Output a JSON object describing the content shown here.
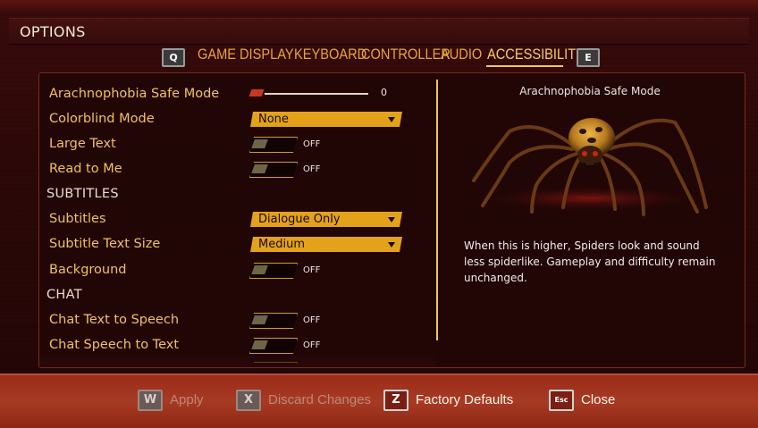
{
  "header": {
    "title": "OPTIONS"
  },
  "tabs": {
    "prev_key": "Q",
    "next_key": "E",
    "items": [
      {
        "label": "GAME"
      },
      {
        "label": "DISPLAY"
      },
      {
        "label": "KEYBOARD"
      },
      {
        "label": "CONTROLLER"
      },
      {
        "label": "AUDIO"
      },
      {
        "label": "ACCESSIBILITY",
        "active": true
      }
    ]
  },
  "settings": {
    "arachnophobia": {
      "label": "Arachnophobia Safe Mode",
      "value": "0",
      "level": 0
    },
    "colorblind": {
      "label": "Colorblind Mode",
      "value": "None"
    },
    "large_text": {
      "label": "Large Text",
      "state": "OFF"
    },
    "read_to_me": {
      "label": "Read to Me",
      "state": "OFF"
    },
    "subtitles_section": "SUBTITLES",
    "subtitles": {
      "label": "Subtitles",
      "value": "Dialogue Only"
    },
    "subtitle_size": {
      "label": "Subtitle Text Size",
      "value": "Medium"
    },
    "background": {
      "label": "Background",
      "state": "OFF"
    },
    "chat_section": "CHAT",
    "chat_tts": {
      "label": "Chat Text to Speech",
      "state": "OFF"
    },
    "chat_stt": {
      "label": "Chat Speech to Text",
      "state": "OFF"
    }
  },
  "preview": {
    "title": "Arachnophobia Safe Mode",
    "description": "When this is higher, Spiders look and sound less spiderlike. Gameplay and difficulty remain unchanged."
  },
  "footer": {
    "apply": {
      "key": "W",
      "label": "Apply"
    },
    "discard": {
      "key": "X",
      "label": "Discard Changes"
    },
    "factory": {
      "key": "Z",
      "label": "Factory Defaults"
    },
    "close": {
      "key": "Esc",
      "label": "Close"
    }
  },
  "colors": {
    "accent": "#f0c25a",
    "dropdown": "#e3a21a",
    "background": "#2a0707",
    "footer": "#a73a22"
  }
}
